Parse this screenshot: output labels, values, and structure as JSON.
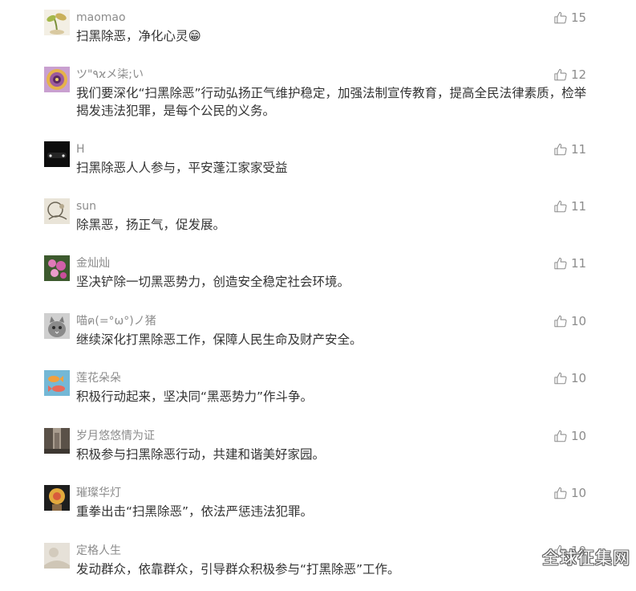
{
  "comments": [
    {
      "nickname": "maomao",
      "text": "扫黑除恶，净化心灵😁",
      "likes": "15",
      "avatar": "sprout-avatar"
    },
    {
      "nickname": "ツ\"٩ϰメ柒;い",
      "text": "我们要深化“扫黑除恶”行动弘扬正气维护稳定，加强法制宣传教育，提高全民法律素质，检举揭发违法犯罪，是每个公民的义务。",
      "likes": "12",
      "avatar": "sunflower-avatar"
    },
    {
      "nickname": "H",
      "text": "扫黑除恶人人参与，平安蓬江家家受益",
      "likes": "11",
      "avatar": "dark-car-avatar"
    },
    {
      "nickname": "sun",
      "text": "除黑恶，扬正气，促发展。",
      "likes": "11",
      "avatar": "sketch-avatar"
    },
    {
      "nickname": "金灿灿",
      "text": "坚决铲除一切黑恶势力，创造安全稳定社会环境。",
      "likes": "11",
      "avatar": "pink-flower-avatar"
    },
    {
      "nickname": "喵ฅ(=°ω°)ノ猪",
      "text": "继续深化打黑除恶工作，保障人民生命及财产安全。",
      "likes": "10",
      "avatar": "cat-avatar"
    },
    {
      "nickname": "莲花朵朵",
      "text": "积极行动起来，坚决同“黑恶势力”作斗争。",
      "likes": "10",
      "avatar": "fish-avatar"
    },
    {
      "nickname": "岁月悠悠情为证",
      "text": "积极参与扫黑除恶行动，共建和谐美好家园。",
      "likes": "10",
      "avatar": "alley-avatar"
    },
    {
      "nickname": "璀璨华灯",
      "text": "重拳出击“扫黑除恶”，依法严惩违法犯罪。",
      "likes": "10",
      "avatar": "flower-pot-avatar"
    },
    {
      "nickname": "定格人生",
      "text": "发动群众，依靠群众，引导群众积极参与“打黑除恶”工作。",
      "likes": "10",
      "avatar": "pale-avatar"
    }
  ],
  "like_icon": "thumbs-up-icon",
  "colors": {
    "nickname": "#8c8c8c",
    "text": "#333333",
    "like": "#8c8c8c",
    "background": "#ffffff"
  },
  "watermark": "全球征集网"
}
